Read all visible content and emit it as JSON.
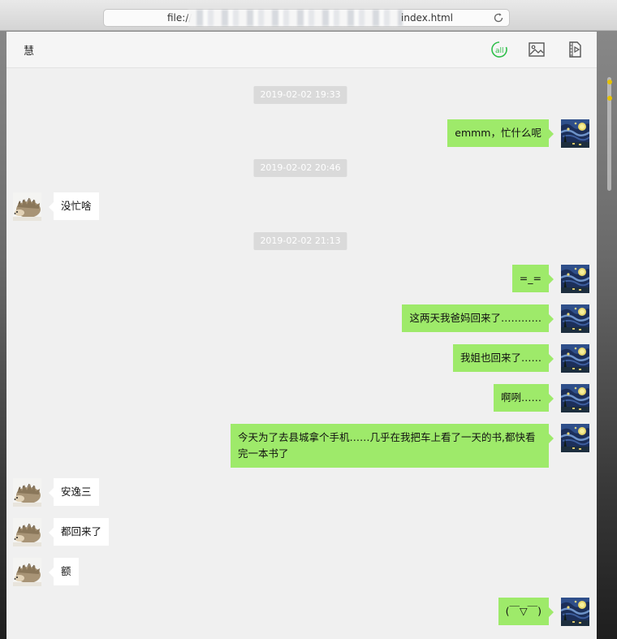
{
  "browser": {
    "url_prefix": "file://",
    "url_suffix": "index.html"
  },
  "chat": {
    "contact_name": "慧",
    "header_icons": [
      "mention-all-icon",
      "image-icon",
      "video-file-icon"
    ],
    "accent_color": "#9eea6a",
    "timestamps": [
      "2019-02-02 19:33",
      "2019-02-02 20:46",
      "2019-02-02 21:13"
    ],
    "messages": [
      {
        "from": "me",
        "text": "emmm，忙什么呢"
      },
      {
        "from": "them",
        "text": "没忙啥"
      },
      {
        "from": "me",
        "text": "=_="
      },
      {
        "from": "me",
        "text": "这两天我爸妈回来了…………"
      },
      {
        "from": "me",
        "text": "我姐也回来了……"
      },
      {
        "from": "me",
        "text": "啊咧……"
      },
      {
        "from": "me",
        "text": "今天为了去县城拿个手机……几乎在我把车上看了一天的书,都快看完一本书了"
      },
      {
        "from": "them",
        "text": "安逸三"
      },
      {
        "from": "them",
        "text": "都回来了"
      },
      {
        "from": "them",
        "text": "额"
      },
      {
        "from": "me",
        "text": "(￣▽￣)"
      }
    ]
  }
}
